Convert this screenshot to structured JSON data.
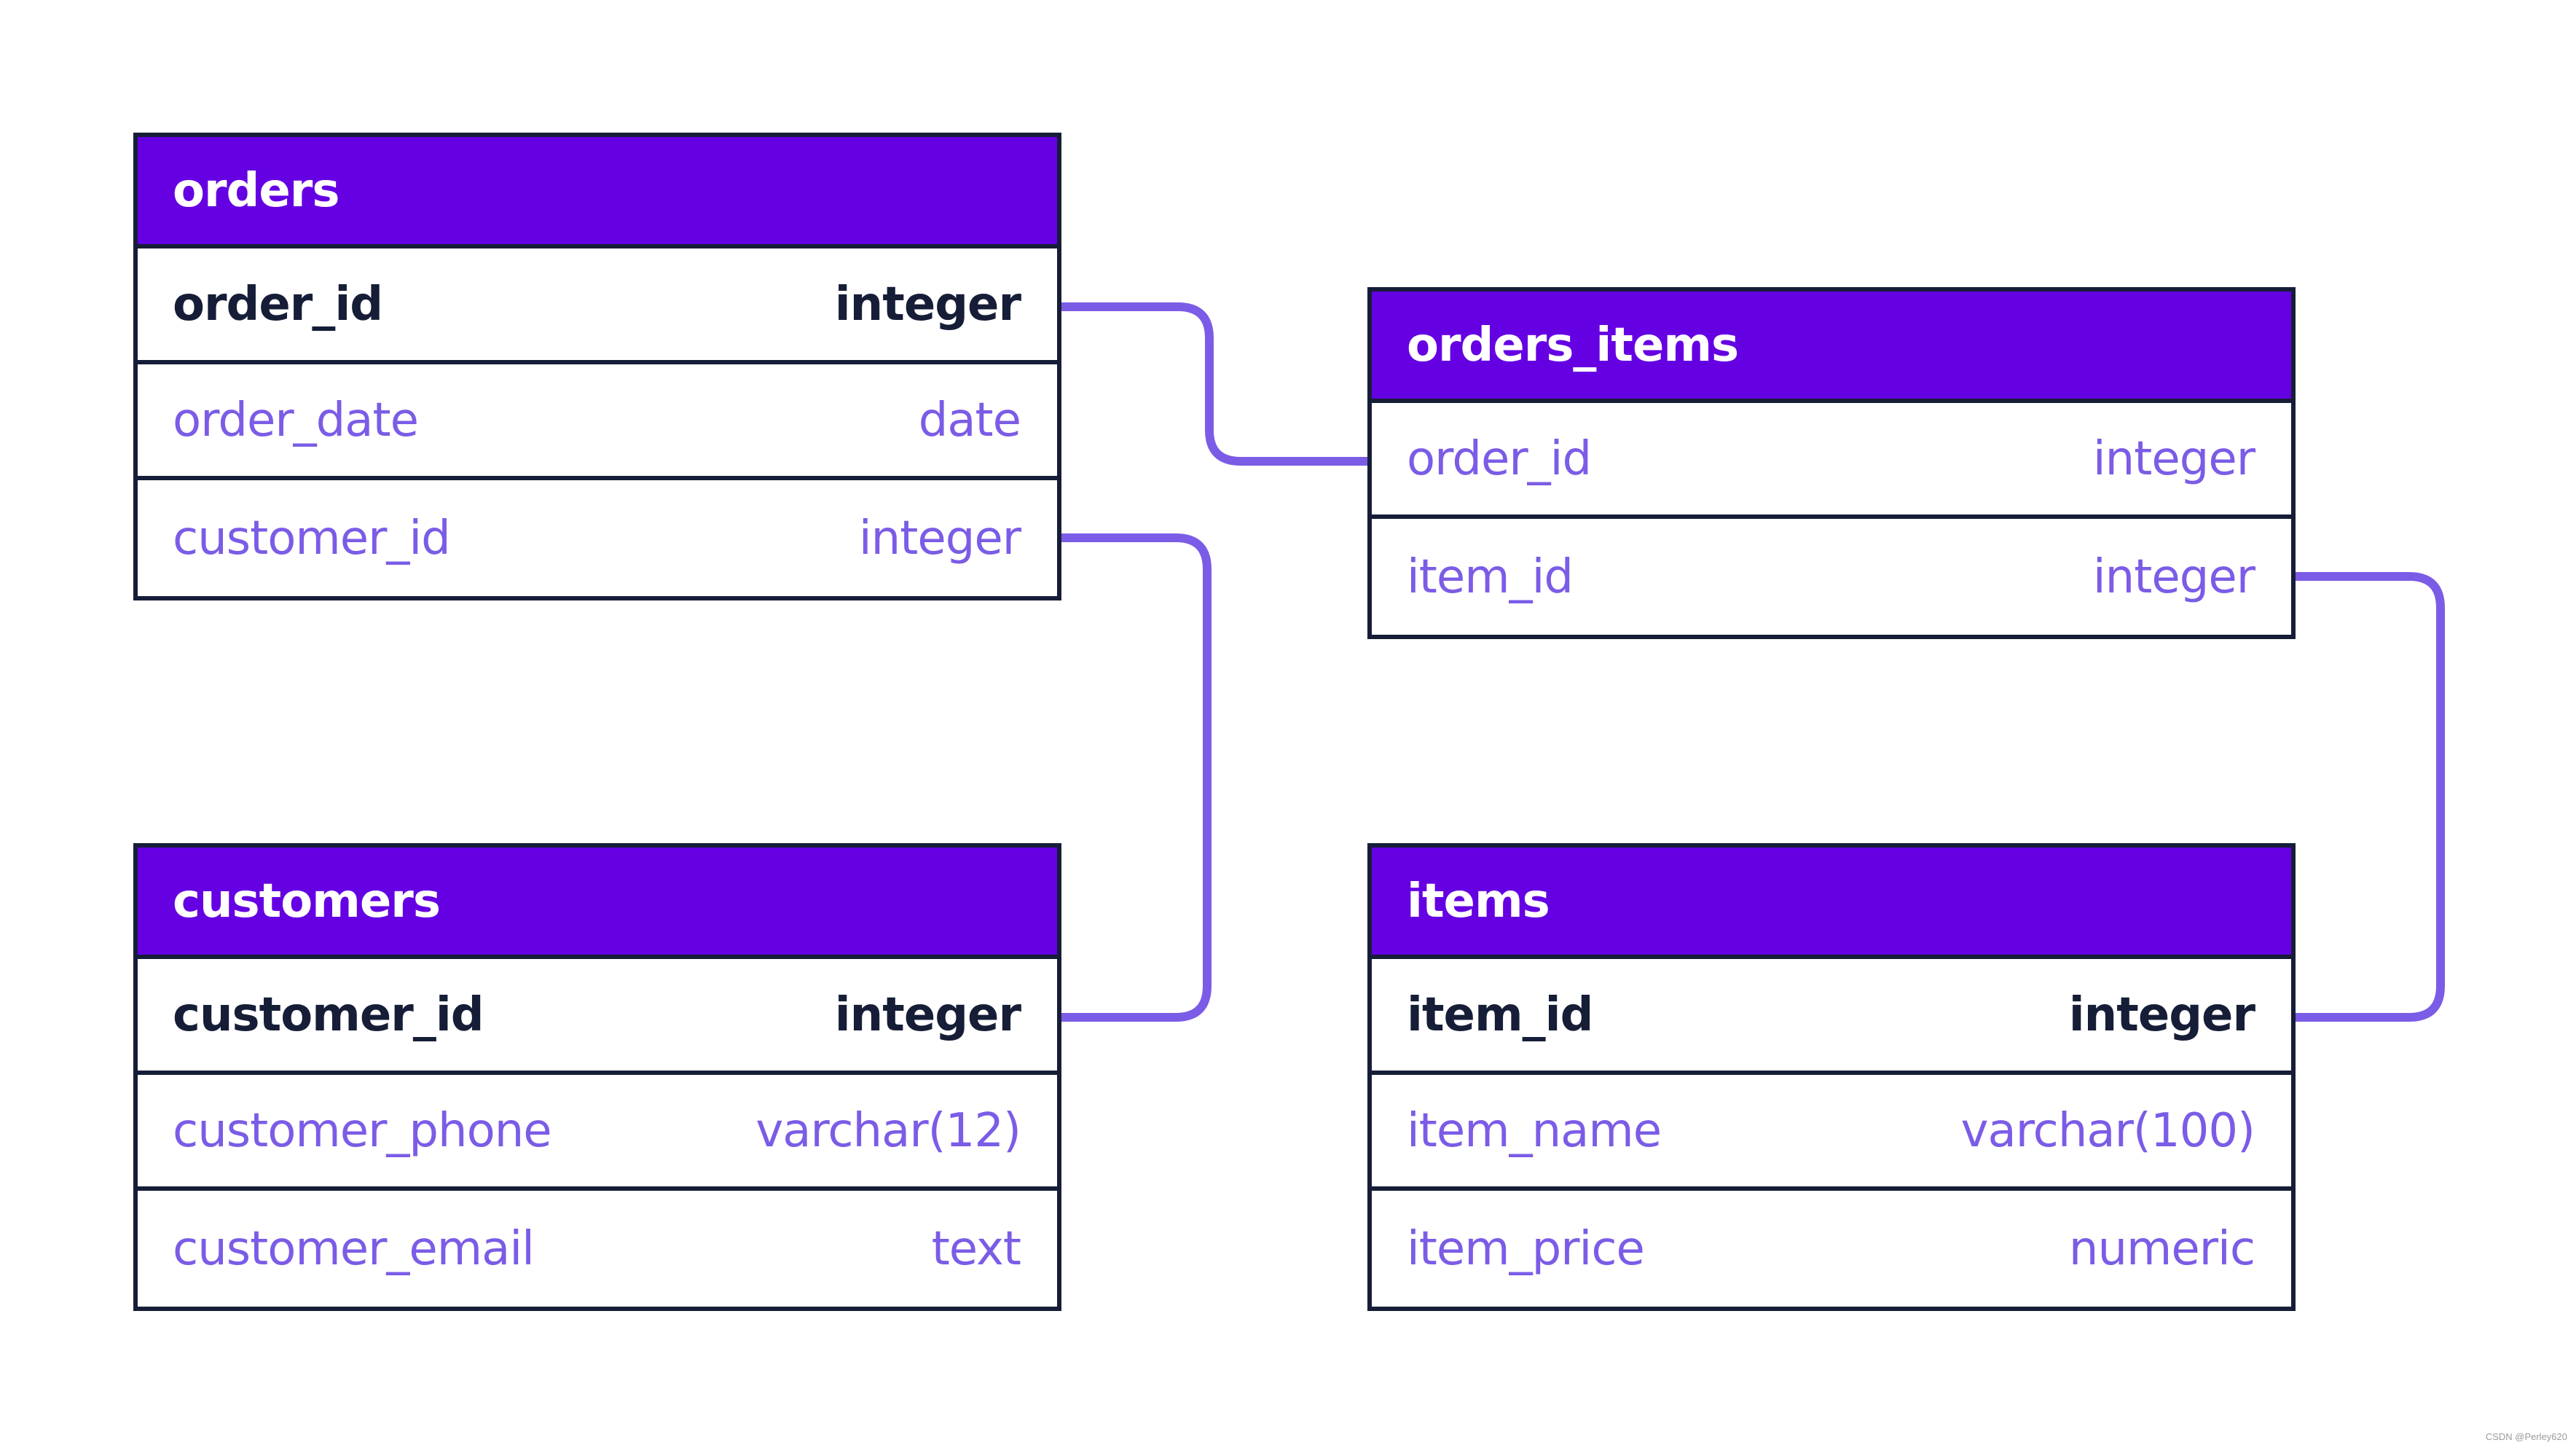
{
  "colors": {
    "header_bg": "#6500e3",
    "border": "#161d37",
    "pk_text": "#161d37",
    "field_text": "#7b5ce6",
    "connector": "#7b5ce6"
  },
  "tables": {
    "orders": {
      "name": "orders",
      "columns": [
        {
          "name": "order_id",
          "type": "integer",
          "primary_key": true
        },
        {
          "name": "order_date",
          "type": "date",
          "primary_key": false
        },
        {
          "name": "customer_id",
          "type": "integer",
          "primary_key": false
        }
      ]
    },
    "orders_items": {
      "name": "orders_items",
      "columns": [
        {
          "name": "order_id",
          "type": "integer",
          "primary_key": false
        },
        {
          "name": "item_id",
          "type": "integer",
          "primary_key": false
        }
      ]
    },
    "customers": {
      "name": "customers",
      "columns": [
        {
          "name": "customer_id",
          "type": "integer",
          "primary_key": true
        },
        {
          "name": "customer_phone",
          "type": "varchar(12)",
          "primary_key": false
        },
        {
          "name": "customer_email",
          "type": "text",
          "primary_key": false
        }
      ]
    },
    "items": {
      "name": "items",
      "columns": [
        {
          "name": "item_id",
          "type": "integer",
          "primary_key": true
        },
        {
          "name": "item_name",
          "type": "varchar(100)",
          "primary_key": false
        },
        {
          "name": "item_price",
          "type": "numeric",
          "primary_key": false
        }
      ]
    }
  },
  "relationships": [
    {
      "from": "orders.order_id",
      "to": "orders_items.order_id"
    },
    {
      "from": "orders.customer_id",
      "to": "customers.customer_id"
    },
    {
      "from": "orders_items.item_id",
      "to": "items.item_id"
    }
  ],
  "watermark": "CSDN @Perley620"
}
